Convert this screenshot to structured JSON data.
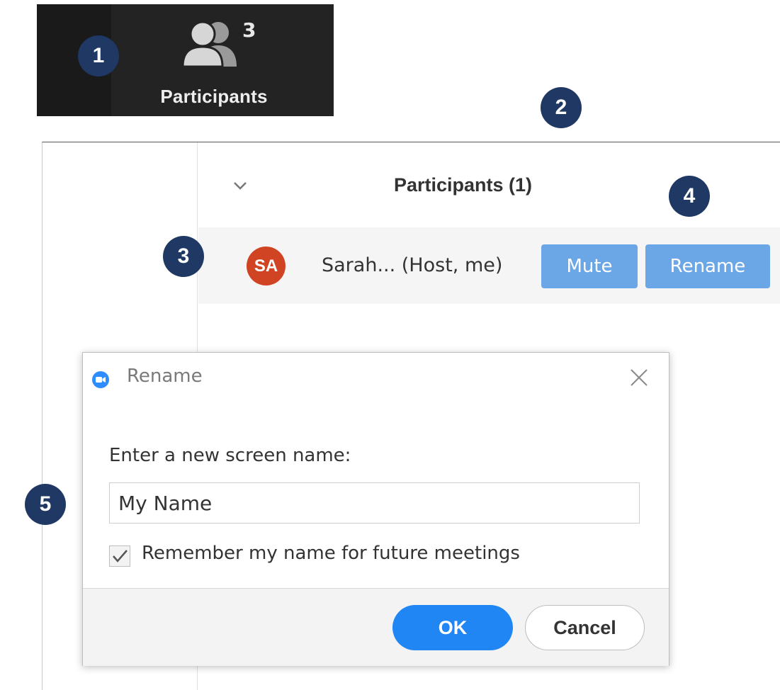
{
  "toolbar": {
    "participants_label": "Participants",
    "participant_count": "3"
  },
  "markers": [
    "1",
    "2",
    "3",
    "4",
    "5"
  ],
  "panel": {
    "title": "Participants (1)",
    "participant": {
      "initials": "SA",
      "name": "Sarah... (Host, me)",
      "avatar_color": "#d04424",
      "mute_label": "Mute",
      "rename_label": "Rename"
    }
  },
  "dialog": {
    "title": "Rename",
    "prompt": "Enter a new screen name:",
    "name_value": "My Name",
    "remember_label": "Remember my name for future meetings",
    "remember_checked": true,
    "ok_label": "OK",
    "cancel_label": "Cancel"
  },
  "colors": {
    "marker": "#1f3864",
    "button_blue": "#6ba6e6",
    "ok_blue": "#1f86f4",
    "toolbar_bg": "#232323"
  }
}
